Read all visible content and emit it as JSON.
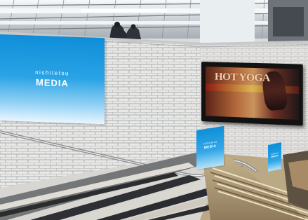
{
  "scene": {
    "type": "station staircase advertising wall",
    "colors": {
      "brick": "#e7e7e5",
      "mortar": "#9b9d9f",
      "sign_blue": "#149ae1",
      "stair_dark": "#2a2b2d"
    }
  },
  "signs": {
    "main": {
      "small": "nishitetsu",
      "big": "MEDIA"
    },
    "mid": {
      "small": "nishitetsu",
      "big": "MEDIA"
    },
    "small": {
      "small": "nishitetsu",
      "big": "MEDIA"
    }
  },
  "digital_ad": {
    "headline": "HOT YOGA"
  }
}
